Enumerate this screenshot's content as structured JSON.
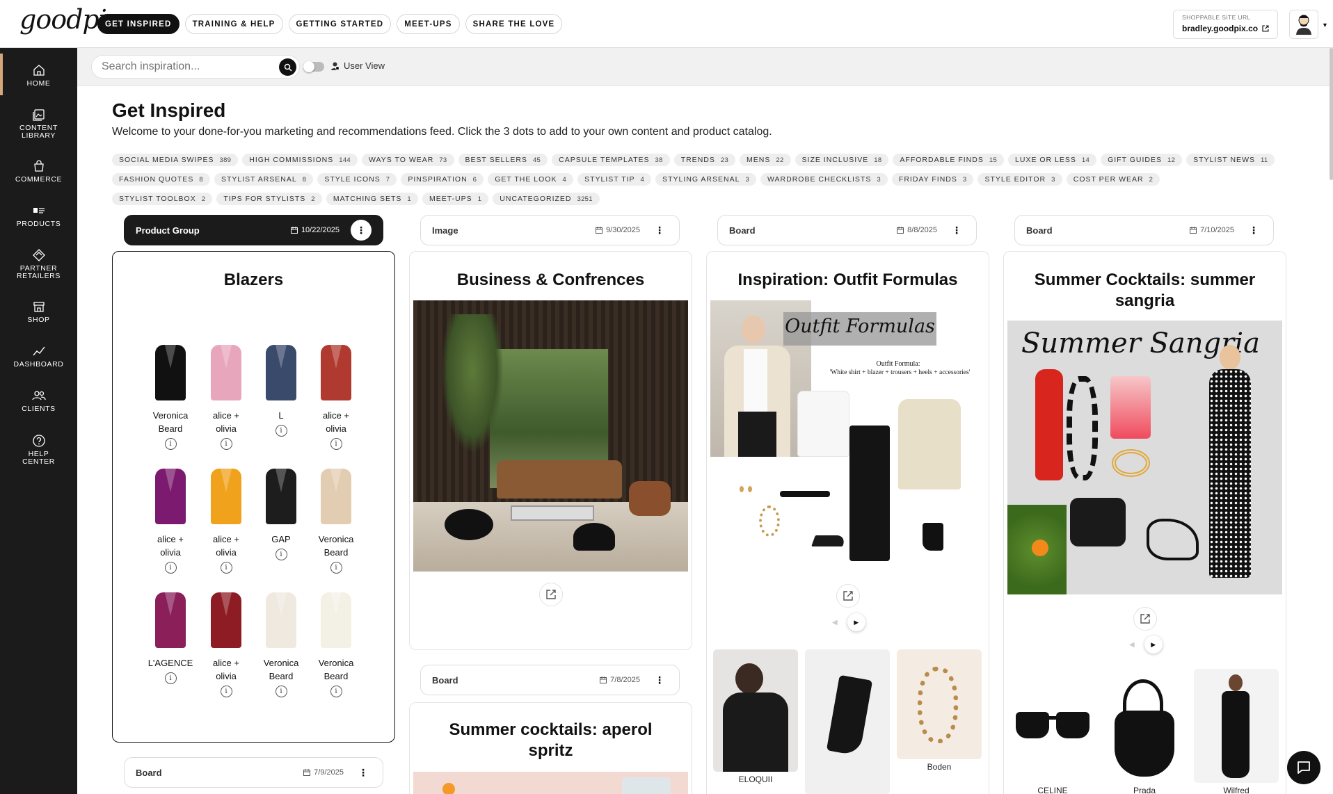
{
  "brand": {
    "logo_text": "goodpix"
  },
  "nav": [
    {
      "label": "GET INSPIRED",
      "active": true
    },
    {
      "label": "TRAINING & HELP",
      "active": false
    },
    {
      "label": "GETTING STARTED",
      "active": false
    },
    {
      "label": "MEET-UPS",
      "active": false
    },
    {
      "label": "SHARE THE LOVE",
      "active": false
    }
  ],
  "site_url": {
    "label": "SHOPPABLE SITE URL",
    "value": "bradley.goodpix.co"
  },
  "sidebar": {
    "items": [
      {
        "label": "HOME",
        "icon": "home-icon",
        "active": true
      },
      {
        "label": "CONTENT LIBRARY",
        "icon": "library-icon"
      },
      {
        "label": "COMMERCE",
        "icon": "bag-icon"
      },
      {
        "label": "PRODUCTS",
        "icon": "products-icon"
      },
      {
        "label": "PARTNER RETAILERS",
        "icon": "diamond-icon"
      },
      {
        "label": "SHOP",
        "icon": "store-icon"
      },
      {
        "label": "DASHBOARD",
        "icon": "chart-icon"
      },
      {
        "label": "CLIENTS",
        "icon": "users-icon"
      },
      {
        "label": "HELP CENTER",
        "icon": "help-icon"
      }
    ]
  },
  "search": {
    "placeholder": "Search inspiration...",
    "user_view_label": "User View"
  },
  "main": {
    "title": "Get Inspired",
    "subtitle": "Welcome to your done-for-you marketing and recommendations feed. Click the 3 dots to add to your own content and product catalog."
  },
  "tags": [
    {
      "label": "SOCIAL MEDIA SWIPES",
      "count": "389"
    },
    {
      "label": "HIGH COMMISSIONS",
      "count": "144"
    },
    {
      "label": "WAYS TO WEAR",
      "count": "73"
    },
    {
      "label": "BEST SELLERS",
      "count": "45"
    },
    {
      "label": "CAPSULE TEMPLATES",
      "count": "38"
    },
    {
      "label": "TRENDS",
      "count": "23"
    },
    {
      "label": "MENS",
      "count": "22"
    },
    {
      "label": "SIZE INCLUSIVE",
      "count": "18"
    },
    {
      "label": "AFFORDABLE FINDS",
      "count": "15"
    },
    {
      "label": "LUXE OR LESS",
      "count": "14"
    },
    {
      "label": "GIFT GUIDES",
      "count": "12"
    },
    {
      "label": "STYLIST NEWS",
      "count": "11"
    },
    {
      "label": "FASHION QUOTES",
      "count": "8"
    },
    {
      "label": "STYLIST ARSENAL",
      "count": "8"
    },
    {
      "label": "STYLE ICONS",
      "count": "7"
    },
    {
      "label": "PINSPIRATION",
      "count": "6"
    },
    {
      "label": "GET THE LOOK",
      "count": "4"
    },
    {
      "label": "STYLIST TIP",
      "count": "4"
    },
    {
      "label": "STYLING ARSENAL",
      "count": "3"
    },
    {
      "label": "WARDROBE CHECKLISTS",
      "count": "3"
    },
    {
      "label": "FRIDAY FINDS",
      "count": "3"
    },
    {
      "label": "STYLE EDITOR",
      "count": "3"
    },
    {
      "label": "COST PER WEAR",
      "count": "2"
    },
    {
      "label": "STYLIST TOOLBOX",
      "count": "2"
    },
    {
      "label": "TIPS FOR STYLISTS",
      "count": "2"
    },
    {
      "label": "MATCHING SETS",
      "count": "1"
    },
    {
      "label": "MEET-UPS",
      "count": "1"
    },
    {
      "label": "UNCATEGORIZED",
      "count": "3251"
    }
  ],
  "cards": {
    "c1": {
      "type": "Product Group",
      "date": "10/22/2025",
      "title": "Blazers"
    },
    "c2": {
      "type": "Image",
      "date": "9/30/2025",
      "title": "Business & Confrences"
    },
    "c3": {
      "type": "Board",
      "date": "8/8/2025",
      "title": "Inspiration: Outfit Formulas",
      "overlay_script": "Outfit Formulas",
      "formula_label": "Outfit Formula:",
      "formula_text": "'White shirt + blazer + trousers + heels + accessories'"
    },
    "c4": {
      "type": "Board",
      "date": "7/10/2025",
      "title": "Summer Cocktails: summer sangria",
      "overlay_script": "Summer Sangria"
    },
    "c5": {
      "type": "Board",
      "date": "7/8/2025",
      "title": "Summer cocktails: aperol spritz"
    },
    "c6": {
      "type": "Board",
      "date": "7/9/2025"
    }
  },
  "blazers": [
    {
      "brand": "Veronica Beard",
      "color": "#111111"
    },
    {
      "brand": "alice + olivia",
      "color": "#e8a6bd"
    },
    {
      "brand": "L",
      "color": "#3a4a6b"
    },
    {
      "brand": "alice + olivia",
      "color": "#b03a30"
    },
    {
      "brand": "alice + olivia",
      "color": "#7b1a6e"
    },
    {
      "brand": "alice + olivia",
      "color": "#f0a21c"
    },
    {
      "brand": "GAP",
      "color": "#1d1d1d"
    },
    {
      "brand": "Veronica Beard",
      "color": "#e3cdb2"
    },
    {
      "brand": "L'AGENCE",
      "color": "#8a1f5a"
    },
    {
      "brand": "alice + olivia",
      "color": "#8e1c24"
    },
    {
      "brand": "Veronica Beard",
      "color": "#efe9df"
    },
    {
      "brand": "Veronica Beard",
      "color": "#f3f0e6"
    }
  ],
  "c3_products": [
    {
      "name": "ELOQUII"
    },
    {
      "name": ""
    },
    {
      "name": "Boden"
    }
  ],
  "c4_products": [
    {
      "name": "CELINE"
    },
    {
      "name": "Prada"
    },
    {
      "name": "Wilfred"
    }
  ]
}
